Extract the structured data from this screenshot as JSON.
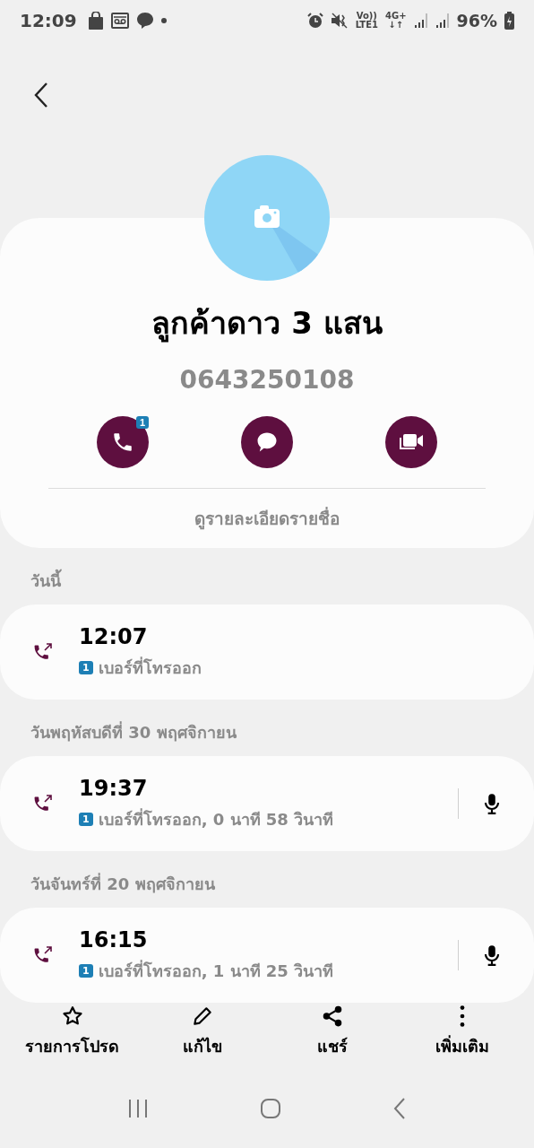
{
  "status_bar": {
    "time": "12:09",
    "volte": "Vo))",
    "lte": "LTE1",
    "network": "4G+",
    "network_arrows": "↓↑",
    "battery": "96%"
  },
  "contact": {
    "name": "ลูกค้าดาว 3 แสน",
    "number": "0643250108",
    "call_badge": "1",
    "details_link": "ดูรายละเอียดรายชื่อ"
  },
  "call_log": [
    {
      "date": "วันนี้",
      "calls": [
        {
          "time": "12:07",
          "sim": "1",
          "detail": "เบอร์ที่โทรออก",
          "recording": false
        }
      ]
    },
    {
      "date": "วันพฤหัสบดีที่ 30 พฤศจิกายน",
      "calls": [
        {
          "time": "19:37",
          "sim": "1",
          "detail": "เบอร์ที่โทรออก, 0 นาที 58 วินาที",
          "recording": true
        }
      ]
    },
    {
      "date": "วันจันทร์ที่ 20 พฤศจิกายน",
      "calls": [
        {
          "time": "16:15",
          "sim": "1",
          "detail": "เบอร์ที่โทรออก, 1 นาที 25 วินาที",
          "recording": true
        }
      ]
    }
  ],
  "bottom_actions": [
    {
      "kind": "favorite",
      "label": "รายการโปรด"
    },
    {
      "kind": "edit",
      "label": "แก้ไข"
    },
    {
      "kind": "share",
      "label": "แชร์"
    },
    {
      "kind": "more",
      "label": "เพิ่มเติม"
    }
  ]
}
